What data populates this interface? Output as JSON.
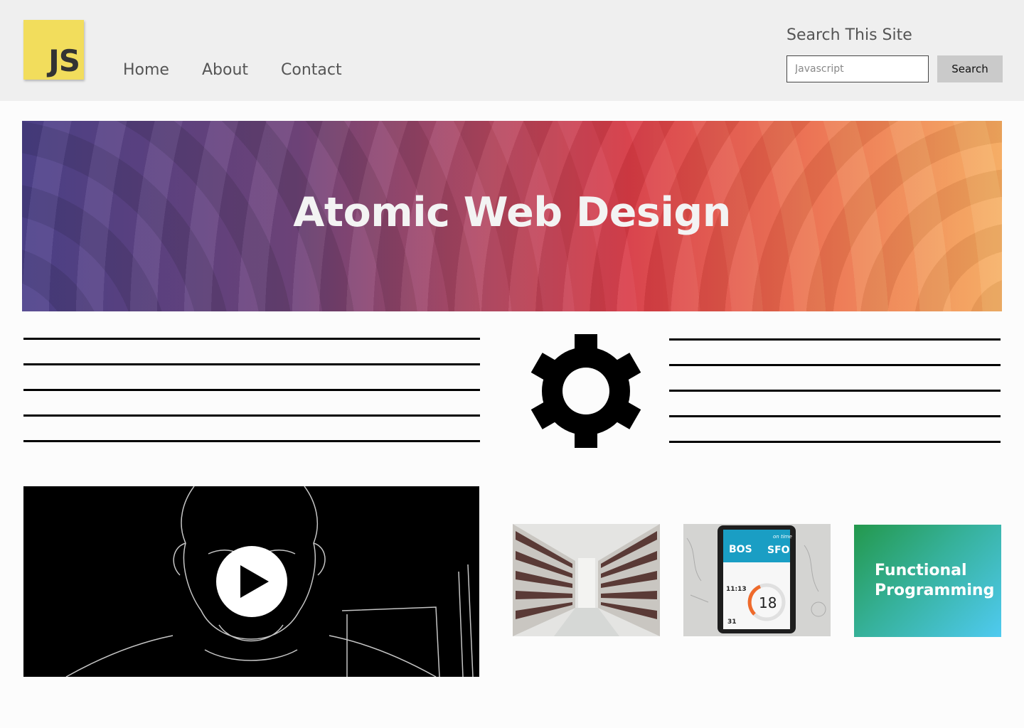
{
  "header": {
    "logo_text": "JS",
    "nav": [
      "Home",
      "About",
      "Contact"
    ],
    "search": {
      "title": "Search This Site",
      "placeholder": "Javascript",
      "button_label": "Search"
    }
  },
  "hero": {
    "title": "Atomic Web Design"
  },
  "features": {
    "icon": "gear-icon"
  },
  "media": {
    "video_icon": "play-icon",
    "thumbnails": [
      {
        "name": "archive-shelves-image"
      },
      {
        "name": "flight-app-image",
        "from": "BOS",
        "to": "SFO",
        "status": "on time",
        "time": "11:13",
        "gate": "18",
        "day": "31"
      },
      {
        "name": "functional-programming-card",
        "label": "Functional Programming"
      }
    ]
  },
  "colors": {
    "logo_yellow": "#f2dd5c",
    "header_bg": "#efefef",
    "search_button": "#cacaca",
    "hero_start": "#4a3f86",
    "hero_mid": "#d93d48",
    "hero_end": "#f6ae63",
    "fp_card_start": "#23984c",
    "fp_card_end": "#4fcaf0"
  }
}
